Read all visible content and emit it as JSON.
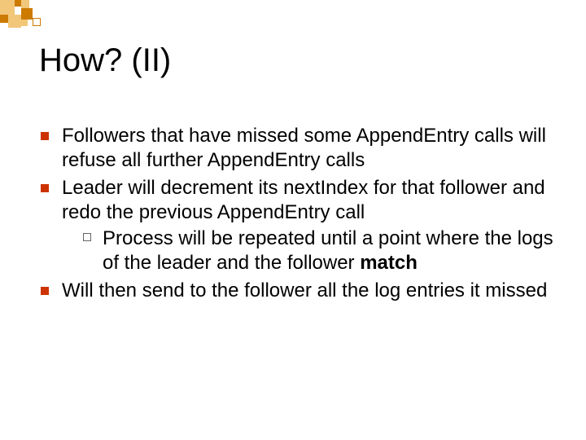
{
  "title": "How? (II)",
  "bullets": {
    "i0": "Followers that have missed some  AppendEntry calls will refuse all further AppendEntry calls",
    "i1": "Leader will decrement its nextIndex for that follower and redo the previous AppendEntry call",
    "i1_0a": "Process will be repeated until a point where the logs of the leader and the follower ",
    "i1_0b": "match",
    "i2": "Will then send  to the follower all the log entries it missed"
  }
}
